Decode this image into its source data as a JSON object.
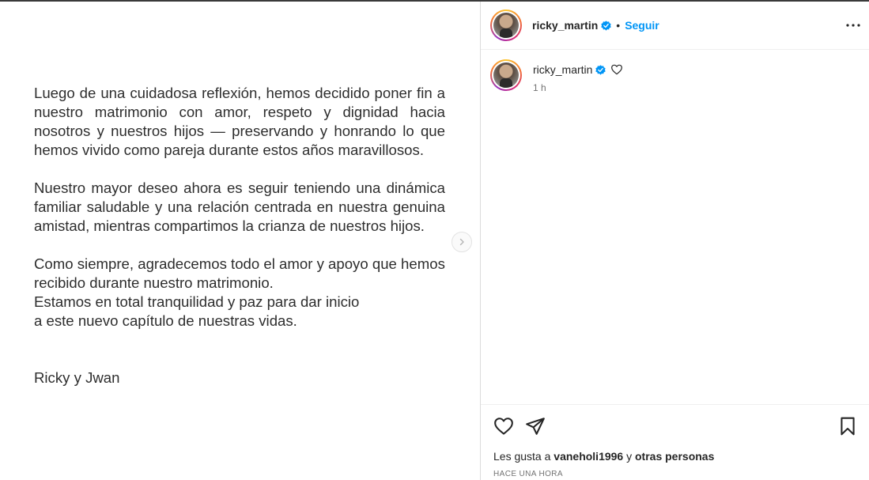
{
  "post": {
    "paragraphs": [
      "Luego de una cuidadosa reflexión, hemos decidido poner fin a nuestro matrimonio con amor, respeto y dignidad hacia nosotros y nuestros hijos — preservando y honrando lo que hemos vivido como pareja durante estos años maravillosos.",
      "Nuestro mayor deseo ahora es seguir teniendo una dinámica familiar saludable y una relación centrada en nuestra genuina amistad, mientras compartimos la crianza de nuestros hijos.",
      "Como siempre, agradecemos todo el amor y apoyo que hemos recibido durante nuestro matrimonio.",
      "Estamos en total tranquilidad y paz para dar inicio",
      "a este nuevo capítulo de nuestras vidas.",
      "Ricky y Jwan"
    ]
  },
  "header": {
    "username": "ricky_martin",
    "separator": "•",
    "follow_label": "Seguir",
    "more_icon": "more-horizontal-icon"
  },
  "caption": {
    "username": "ricky_martin",
    "time": "1 h"
  },
  "footer": {
    "likes_prefix": "Les gusta a ",
    "likes_user": "vaneholi1996",
    "likes_mid": " y ",
    "likes_others": "otras personas",
    "timestamp": "HACE UNA HORA"
  },
  "colors": {
    "accent": "#0095f6",
    "verified": "#0095f6",
    "text": "#262626",
    "muted": "#737373"
  }
}
